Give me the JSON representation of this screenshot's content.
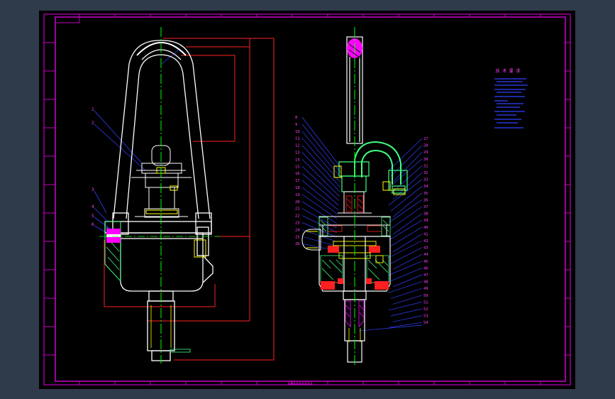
{
  "drawing": {
    "colors": {
      "window_bg": "#2f3a4a",
      "sheet_bg": "#000000",
      "frame": "#c000c0",
      "geometry": "#ffffff",
      "centerline": "#00ff00",
      "dimension": "#ff2020",
      "leader": "#3040ff",
      "hatch_green": "#40ff80",
      "hatch_red": "#ff2020",
      "hatch_magenta": "#ff00ff",
      "yellow": "#ffff00",
      "part_number": "#ff40ff"
    },
    "left_view": {
      "part_numbers": [
        "1",
        "2",
        "3",
        "4",
        "5",
        "6"
      ]
    },
    "right_view": {
      "part_numbers_left": [
        "8",
        "9",
        "10",
        "11",
        "12",
        "13",
        "14",
        "15",
        "16",
        "17",
        "18",
        "19",
        "20",
        "21",
        "22",
        "23",
        "24",
        "25",
        "26"
      ],
      "part_numbers_right": [
        "27",
        "28",
        "29",
        "30",
        "31",
        "32",
        "33",
        "34",
        "35",
        "36",
        "37",
        "38",
        "39",
        "40",
        "41",
        "42",
        "43",
        "44",
        "45",
        "46",
        "47",
        "48",
        "49",
        "50",
        "51",
        "52",
        "53",
        "54"
      ]
    },
    "notes_title": "技 术 要 求"
  }
}
